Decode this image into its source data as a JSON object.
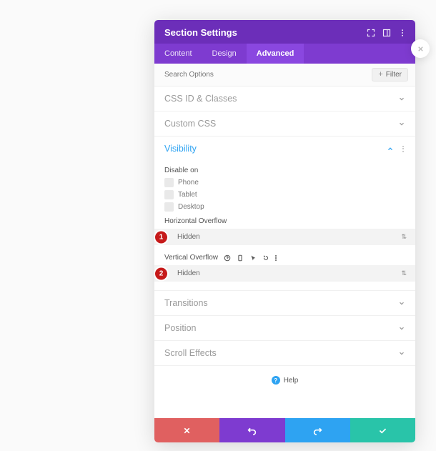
{
  "modal": {
    "title": "Section Settings",
    "tabs": [
      "Content",
      "Design",
      "Advanced"
    ],
    "active_tab": 2,
    "search_placeholder": "Search Options",
    "filter_label": "Filter"
  },
  "groups": {
    "css_id": "CSS ID & Classes",
    "custom_css": "Custom CSS",
    "visibility": "Visibility",
    "transitions": "Transitions",
    "position": "Position",
    "scroll_effects": "Scroll Effects"
  },
  "visibility": {
    "disable_label": "Disable on",
    "device_options": [
      "Phone",
      "Tablet",
      "Desktop"
    ],
    "horizontal_label": "Horizontal Overflow",
    "horizontal_value": "Hidden",
    "vertical_label": "Vertical Overflow",
    "vertical_value": "Hidden"
  },
  "callouts": {
    "one": "1",
    "two": "2"
  },
  "help_label": "Help"
}
